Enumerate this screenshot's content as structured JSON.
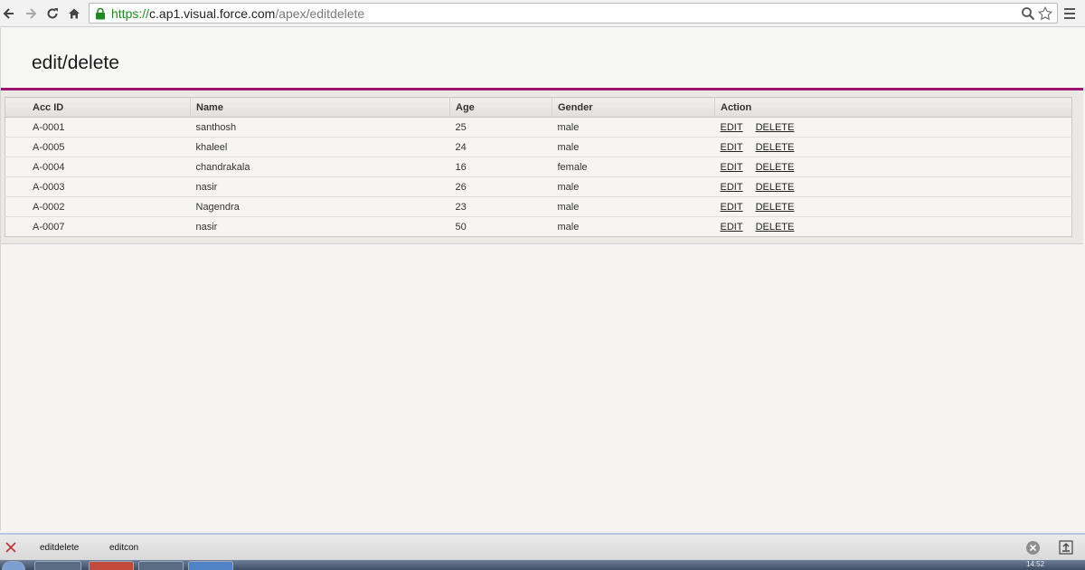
{
  "browser": {
    "url_scheme": "https://",
    "url_host": "c.ap1.visual.force.com",
    "url_path": "/apex/editdelete"
  },
  "page": {
    "title": "edit/delete"
  },
  "table": {
    "headers": [
      "Acc ID",
      "Name",
      "Age",
      "Gender",
      "Action"
    ],
    "edit_label": "EDIT",
    "delete_label": "DELETE",
    "rows": [
      {
        "id": "A-0001",
        "name": "santhosh",
        "age": "25",
        "gender": "male"
      },
      {
        "id": "A-0005",
        "name": "khaleel",
        "age": "24",
        "gender": "male"
      },
      {
        "id": "A-0004",
        "name": "chandrakala",
        "age": "16",
        "gender": "female"
      },
      {
        "id": "A-0003",
        "name": "nasir",
        "age": "26",
        "gender": "male"
      },
      {
        "id": "A-0002",
        "name": "Nagendra",
        "age": "23",
        "gender": "male"
      },
      {
        "id": "A-0007",
        "name": "nasir",
        "age": "50",
        "gender": "male"
      }
    ]
  },
  "downloads": {
    "items": [
      "editdelete",
      "editcon"
    ]
  },
  "taskbar": {
    "clock": "14:52"
  },
  "colors": {
    "accent": "#a0166e",
    "secure": "#1f8a1f"
  }
}
